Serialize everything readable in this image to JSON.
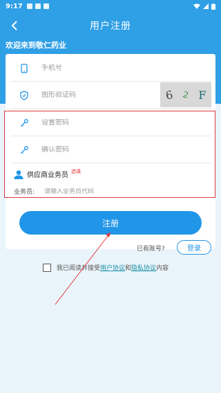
{
  "status_bar": {
    "time": "9:17"
  },
  "nav": {
    "title": "用户注册"
  },
  "welcome": "欢迎来到敬仁药业",
  "form": {
    "phone_placeholder": "手机号",
    "captcha_placeholder": "图形验证码",
    "captcha_text": [
      "6",
      "2",
      "F"
    ],
    "password_placeholder": "设置密码",
    "confirm_placeholder": "确认密码",
    "supplier_label": "供应商业务员",
    "supplier_optional": "选填",
    "agent_label": "业务员:",
    "agent_placeholder": "请输入业务员代码"
  },
  "actions": {
    "register_label": "注册",
    "have_account": "已有账号?",
    "login_label": "登录"
  },
  "agreement": {
    "prefix": "我已阅读并接受",
    "user_agreement": "用户协议",
    "and": "和",
    "privacy_agreement": "隐私协议",
    "suffix": "内容"
  },
  "colors": {
    "primary": "#2196e8",
    "header": "#2f9fe6",
    "highlight": "#e0393e"
  }
}
